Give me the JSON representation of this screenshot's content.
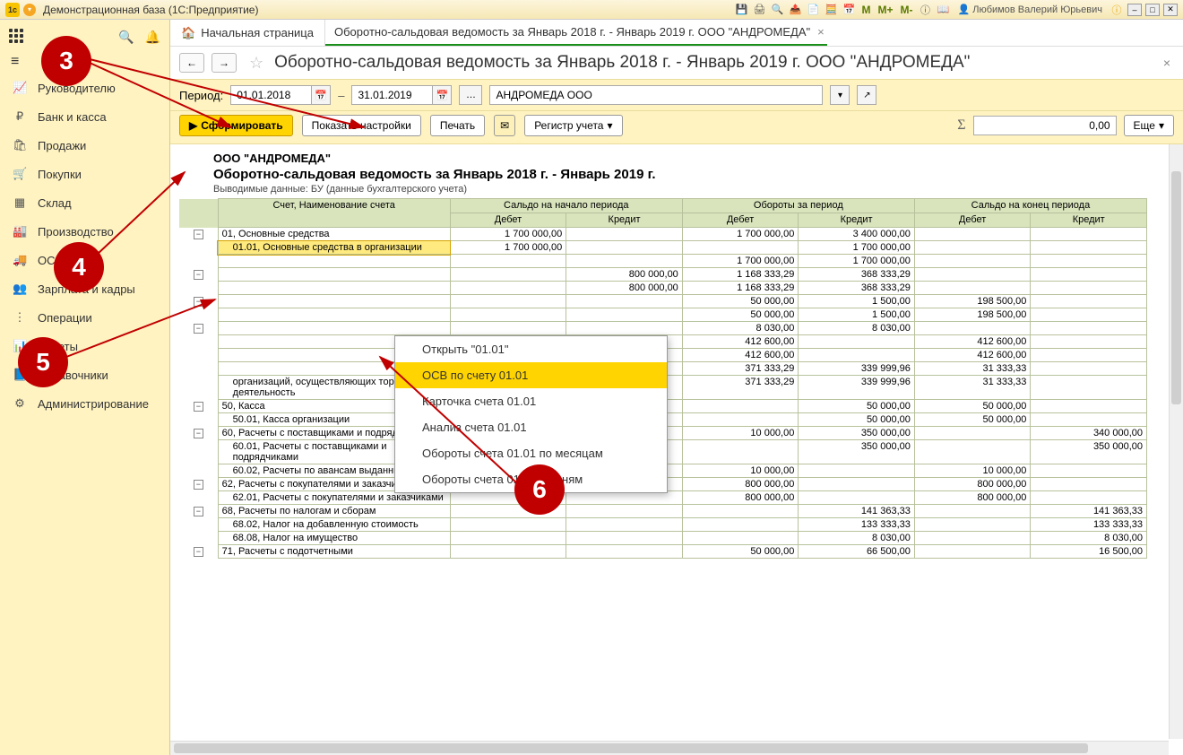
{
  "titlebar": {
    "app_title": "Демонстрационная база  (1С:Предприятие)",
    "m_buttons": [
      "M",
      "M+",
      "M-"
    ],
    "user_name": "Любимов Валерий Юрьевич"
  },
  "sidebar": {
    "items": [
      {
        "icon": "📈",
        "label": "Руководителю"
      },
      {
        "icon": "₽",
        "label": "Банк и касса"
      },
      {
        "icon": "🛍",
        "label": "Продажи"
      },
      {
        "icon": "🛒",
        "label": "Покупки"
      },
      {
        "icon": "▦",
        "label": "Склад"
      },
      {
        "icon": "🏭",
        "label": "Производство"
      },
      {
        "icon": "🚚",
        "label": "ОС и НМА"
      },
      {
        "icon": "👥",
        "label": "Зарплата и кадры"
      },
      {
        "icon": "⋮",
        "label": "Операции"
      },
      {
        "icon": "📊",
        "label": "Отчеты"
      },
      {
        "icon": "📘",
        "label": "Справочники"
      },
      {
        "icon": "⚙",
        "label": "Администрирование"
      }
    ]
  },
  "tabs": {
    "home": "Начальная страница",
    "active": "Оборотно-сальдовая ведомость за Январь 2018 г. - Январь 2019 г. ООО \"АНДРОМЕДА\""
  },
  "page_title": "Оборотно-сальдовая ведомость за Январь 2018 г. - Январь 2019 г. ООО \"АНДРОМЕДА\"",
  "period": {
    "label": "Период:",
    "from": "01.01.2018",
    "to": "31.01.2019",
    "org": "АНДРОМЕДА ООО"
  },
  "toolbar": {
    "form": "Сформировать",
    "show_settings": "Показать настройки",
    "print": "Печать",
    "register": "Регистр учета",
    "sum_value": "0,00",
    "more": "Еще"
  },
  "report": {
    "org": "ООО \"АНДРОМЕДА\"",
    "title": "Оборотно-сальдовая ведомость за Январь 2018 г. - Январь 2019 г.",
    "subtitle": "Выводимые данные: БУ (данные бухгалтерского учета)",
    "headers": {
      "acct": "Счет, Наименование счета",
      "start": "Сальдо на начало периода",
      "turn": "Обороты за период",
      "end": "Сальдо на конец периода",
      "debit": "Дебет",
      "credit": "Кредит"
    },
    "rows": [
      {
        "toggle": "-",
        "indent": 0,
        "name": "01, Основные средства",
        "sd": "1 700 000,00",
        "sc": "",
        "td": "1 700 000,00",
        "tc": "3 400 000,00",
        "ed": "",
        "ec": ""
      },
      {
        "toggle": "",
        "indent": 1,
        "name": "01.01, Основные средства в организации",
        "sd": "1 700 000,00",
        "sc": "",
        "td": "",
        "tc": "1 700 000,00",
        "ed": "",
        "ec": "",
        "hl": true
      },
      {
        "toggle": "",
        "indent": 1,
        "name": "",
        "sd": "",
        "sc": "",
        "td": "1 700 000,00",
        "tc": "1 700 000,00",
        "ed": "",
        "ec": ""
      },
      {
        "toggle": "-",
        "indent": 0,
        "name": "",
        "sd": "",
        "sc": "800 000,00",
        "td": "1 168 333,29",
        "tc": "368 333,29",
        "ed": "",
        "ec": ""
      },
      {
        "toggle": "",
        "indent": 1,
        "name": "",
        "sd": "",
        "sc": "800 000,00",
        "td": "1 168 333,29",
        "tc": "368 333,29",
        "ed": "",
        "ec": ""
      },
      {
        "toggle": "-",
        "indent": 0,
        "name": "",
        "sd": "",
        "sc": "",
        "td": "50 000,00",
        "tc": "1 500,00",
        "ed": "198 500,00",
        "ec": ""
      },
      {
        "toggle": "",
        "indent": 1,
        "name": "",
        "sd": "",
        "sc": "",
        "td": "50 000,00",
        "tc": "1 500,00",
        "ed": "198 500,00",
        "ec": ""
      },
      {
        "toggle": "-",
        "indent": 0,
        "name": "",
        "sd": "",
        "sc": "",
        "td": "8 030,00",
        "tc": "8 030,00",
        "ed": "",
        "ec": ""
      },
      {
        "toggle": "",
        "indent": 1,
        "name": "",
        "sd": "",
        "sc": "",
        "td": "412 600,00",
        "tc": "",
        "ed": "412 600,00",
        "ec": ""
      },
      {
        "toggle": "",
        "indent": 1,
        "name": "",
        "sd": "",
        "sc": "",
        "td": "412 600,00",
        "tc": "",
        "ed": "412 600,00",
        "ec": ""
      },
      {
        "toggle": "",
        "indent": 1,
        "name": "",
        "sd": "",
        "sc": "",
        "td": "371 333,29",
        "tc": "339 999,96",
        "ed": "31 333,33",
        "ec": ""
      },
      {
        "toggle": "",
        "indent": 1,
        "name": "организаций, осуществляющих торговую деятельность",
        "sd": "",
        "sc": "",
        "td": "371 333,29",
        "tc": "339 999,96",
        "ed": "31 333,33",
        "ec": ""
      },
      {
        "toggle": "-",
        "indent": 0,
        "name": "50, Касса",
        "sd": "100 000,00",
        "sc": "",
        "td": "",
        "tc": "50 000,00",
        "ed": "50 000,00",
        "ec": ""
      },
      {
        "toggle": "",
        "indent": 1,
        "name": "50.01, Касса организации",
        "sd": "100 000,00",
        "sc": "",
        "td": "",
        "tc": "50 000,00",
        "ed": "50 000,00",
        "ec": ""
      },
      {
        "toggle": "-",
        "indent": 0,
        "name": "60, Расчеты с поставщиками и подрядчиками",
        "sd": "",
        "sc": "",
        "td": "10 000,00",
        "tc": "350 000,00",
        "ed": "",
        "ec": "340 000,00"
      },
      {
        "toggle": "",
        "indent": 1,
        "name": "60.01, Расчеты с поставщиками и подрядчиками",
        "sd": "",
        "sc": "",
        "td": "",
        "tc": "350 000,00",
        "ed": "",
        "ec": "350 000,00"
      },
      {
        "toggle": "",
        "indent": 1,
        "name": "60.02, Расчеты по авансам выданным",
        "sd": "",
        "sc": "",
        "td": "10 000,00",
        "tc": "",
        "ed": "10 000,00",
        "ec": ""
      },
      {
        "toggle": "-",
        "indent": 0,
        "name": "62, Расчеты с покупателями и заказчиками",
        "sd": "",
        "sc": "",
        "td": "800 000,00",
        "tc": "",
        "ed": "800 000,00",
        "ec": ""
      },
      {
        "toggle": "",
        "indent": 1,
        "name": "62.01, Расчеты с покупателями и заказчиками",
        "sd": "",
        "sc": "",
        "td": "800 000,00",
        "tc": "",
        "ed": "800 000,00",
        "ec": ""
      },
      {
        "toggle": "-",
        "indent": 0,
        "name": "68, Расчеты по налогам и сборам",
        "sd": "",
        "sc": "",
        "td": "",
        "tc": "141 363,33",
        "ed": "",
        "ec": "141 363,33"
      },
      {
        "toggle": "",
        "indent": 1,
        "name": "68.02, Налог на добавленную стоимость",
        "sd": "",
        "sc": "",
        "td": "",
        "tc": "133 333,33",
        "ed": "",
        "ec": "133 333,33"
      },
      {
        "toggle": "",
        "indent": 1,
        "name": "68.08, Налог на имущество",
        "sd": "",
        "sc": "",
        "td": "",
        "tc": "8 030,00",
        "ed": "",
        "ec": "8 030,00"
      },
      {
        "toggle": "-",
        "indent": 0,
        "name": "71, Расчеты с подотчетными",
        "sd": "",
        "sc": "",
        "td": "50 000,00",
        "tc": "66 500,00",
        "ed": "",
        "ec": "16 500,00"
      }
    ]
  },
  "context_menu": {
    "items": [
      "Открыть \"01.01\"",
      "ОСВ по счету 01.01",
      "Карточка счета 01.01",
      "Анализ счета 01.01",
      "Обороты счета 01.01 по месяцам",
      "Обороты счета 01.01 по дням"
    ],
    "selected_index": 1
  },
  "annotations": {
    "n3": "3",
    "n4": "4",
    "n5": "5",
    "n6": "6"
  }
}
